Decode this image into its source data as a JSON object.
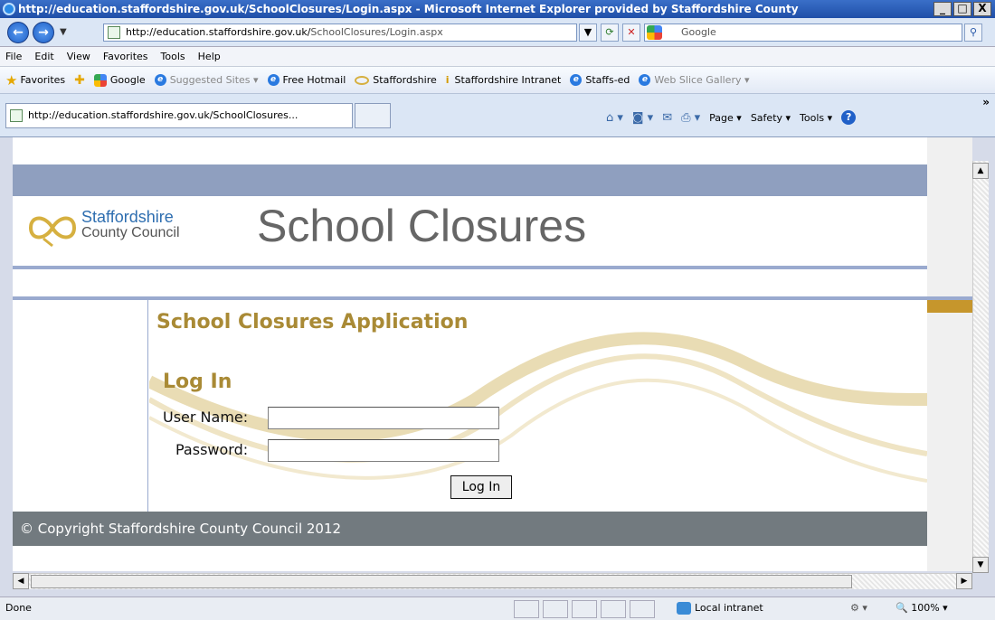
{
  "window": {
    "title": "http://education.staffordshire.gov.uk/SchoolClosures/Login.aspx - Microsoft Internet Explorer provided by Staffordshire County",
    "buttons": [
      "_",
      "□",
      "X"
    ]
  },
  "address_bar": {
    "url_prefix": "http://education.staffordshire.gov.uk/",
    "url_suffix": "SchoolClosures/Login.aspx",
    "search_placeholder": "Google"
  },
  "menu": [
    "File",
    "Edit",
    "View",
    "Favorites",
    "Tools",
    "Help"
  ],
  "favorites_bar": {
    "label": "Favorites",
    "items": [
      {
        "label": "Google",
        "icon": "google-icon"
      },
      {
        "label": "Suggested Sites ▾",
        "icon": "ie-icon"
      },
      {
        "label": "Free Hotmail",
        "icon": "ie-icon"
      },
      {
        "label": "Staffordshire",
        "icon": "knot-icon"
      },
      {
        "label": "Staffordshire Intranet",
        "icon": "info-icon"
      },
      {
        "label": "Staffs-ed",
        "icon": "ie-icon"
      },
      {
        "label": "Web Slice Gallery ▾",
        "icon": "ie-icon"
      }
    ]
  },
  "tab": {
    "label": "http://education.staffordshire.gov.uk/SchoolClosures..."
  },
  "command_bar": {
    "page": "Page ▾",
    "safety": "Safety ▾",
    "tools": "Tools ▾",
    "help": "?",
    "more": "»"
  },
  "page": {
    "logo_line1": "Staffordshire",
    "logo_line2": "County Council",
    "site_title": "School Closures",
    "app_title": "School Closures Application",
    "login_heading": "Log In",
    "username_label": "User Name:",
    "username_value": "",
    "password_label": "Password:",
    "password_value": "",
    "login_button": "Log In",
    "footer": "© Copyright Staffordshire County Council 2012"
  },
  "status_bar": {
    "text": "Done",
    "zone": "Local intranet",
    "zoom": "100%"
  },
  "colors": {
    "accent_gold": "#a98a35",
    "band_blue": "#8f9fbf",
    "footer_grey": "#727a7f"
  }
}
